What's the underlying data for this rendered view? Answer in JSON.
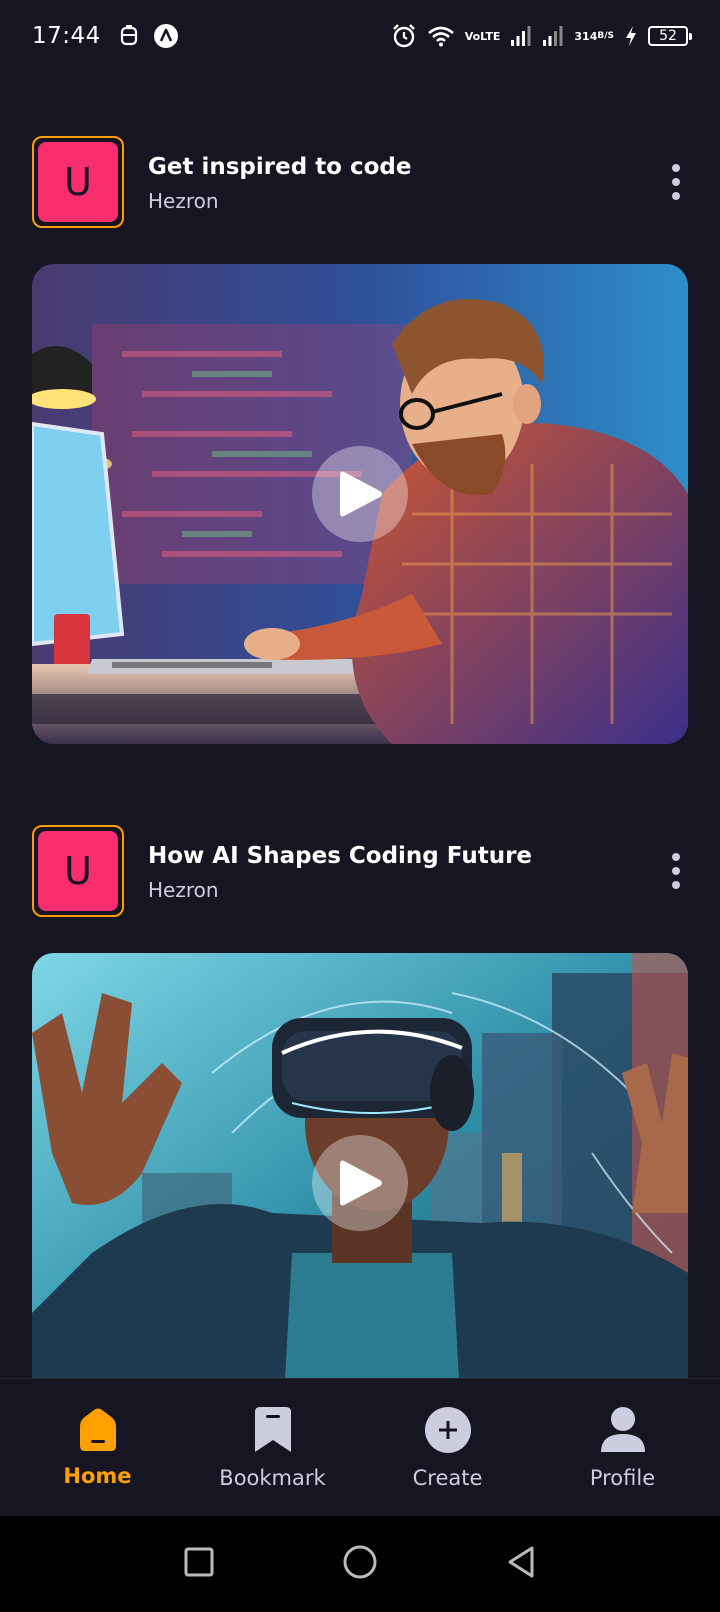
{
  "status_bar": {
    "time": "17:44",
    "net_speed_value": "314",
    "net_speed_unit": "B/S",
    "battery": "52",
    "volte_top": "Vo",
    "volte_bottom": "LTE"
  },
  "posts": [
    {
      "avatar_letter": "U",
      "title": "Get inspired to code",
      "author": "Hezron",
      "thumbnail": "coder-at-laptop-illustration"
    },
    {
      "avatar_letter": "U",
      "title": "How AI Shapes Coding Future",
      "author": "Hezron",
      "thumbnail": "vr-headset-city-illustration"
    }
  ],
  "tabs": [
    {
      "label": "Home",
      "icon": "home-icon",
      "active": true
    },
    {
      "label": "Bookmark",
      "icon": "bookmark-icon",
      "active": false
    },
    {
      "label": "Create",
      "icon": "plus-circle-icon",
      "active": false
    },
    {
      "label": "Profile",
      "icon": "profile-icon",
      "active": false
    }
  ],
  "colors": {
    "background": "#161622",
    "accent": "#FFA001",
    "avatar_bg": "#F82D6E",
    "muted_text": "#CDCDE0"
  }
}
